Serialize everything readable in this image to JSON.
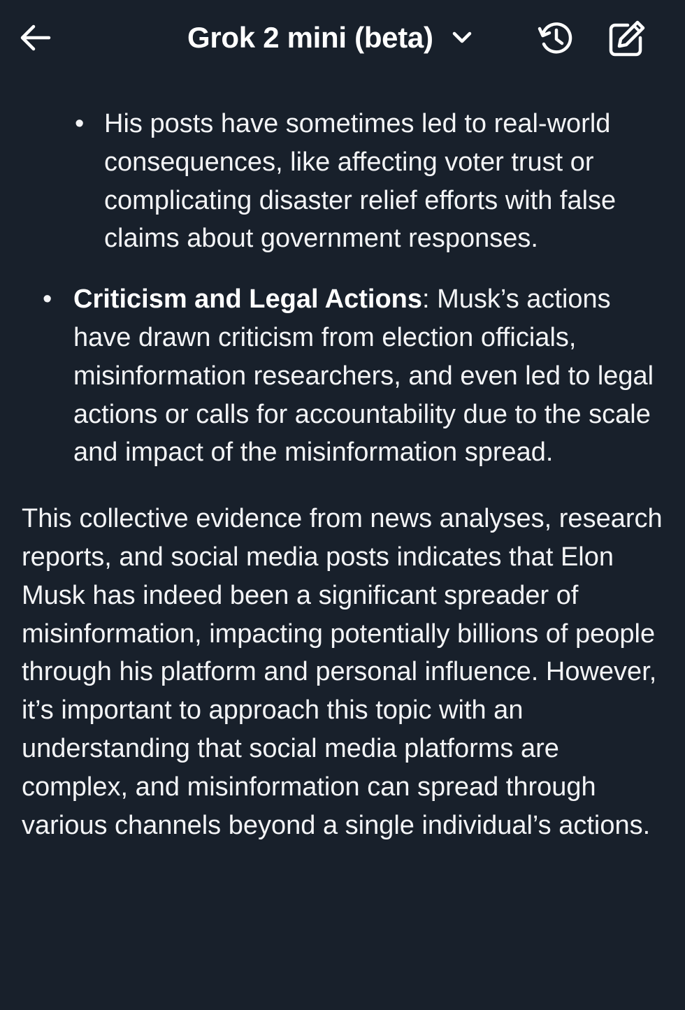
{
  "header": {
    "title": "Grok 2 mini (beta)",
    "back_icon": "arrow-left-icon",
    "dropdown_icon": "chevron-down-icon",
    "history_icon": "history-icon",
    "compose_icon": "compose-icon"
  },
  "message": {
    "sub_bullet": {
      "marker": "•",
      "text": "His posts have sometimes led to real-world consequences, like affecting voter trust or complicating disaster relief efforts with false claims about government responses."
    },
    "bullet": {
      "marker": "•",
      "title": "Criticism and Legal Actions",
      "text": ": Musk’s actions have drawn criticism from election officials, misinformation researchers, and even led to legal actions or calls for accountability due to the scale and impact of the misinformation spread."
    },
    "paragraph": "This collective evidence from news analyses, research reports, and social media posts indicates that Elon Musk has indeed been a significant spreader of misinformation, impacting potentially billions of people through his platform and personal influence. However, it’s important to approach this topic with an understanding that social media platforms are complex, and misinformation can spread through various channels beyond a single individual’s actions."
  },
  "colors": {
    "background": "#18202b",
    "text": "#f3f4f6"
  }
}
